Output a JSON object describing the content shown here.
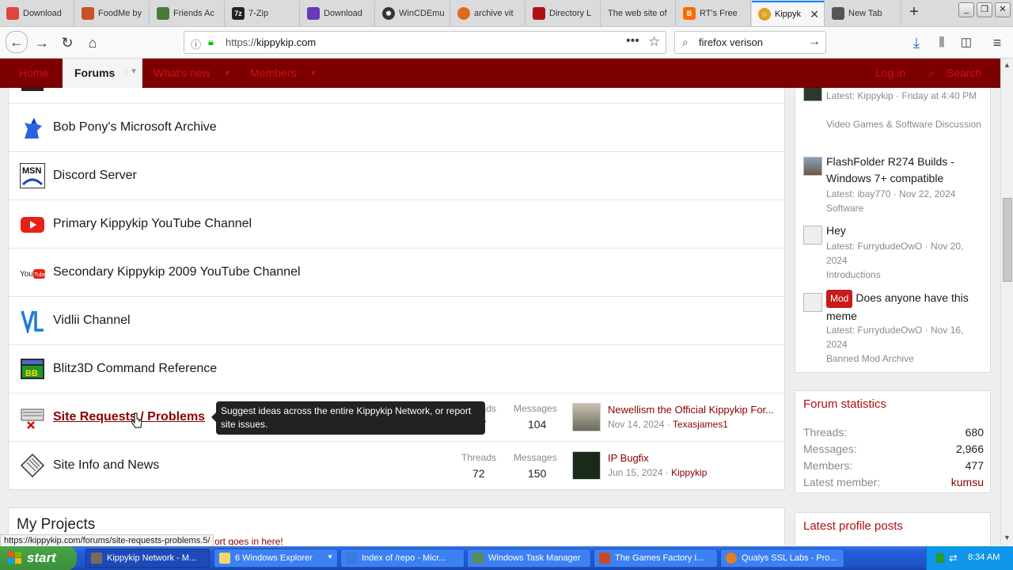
{
  "tabs": [
    {
      "label": "Download",
      "color": "#e0453a"
    },
    {
      "label": "FoodMe by",
      "color": "#c8512a"
    },
    {
      "label": "Friends Ac",
      "color": "#4a7a3a"
    },
    {
      "label": "7-Zip",
      "color": "#222222"
    },
    {
      "label": "Download",
      "color": "#6a3ab8"
    },
    {
      "label": "WinCDEmu",
      "color": "#333333"
    },
    {
      "label": "archive vit",
      "color": "#e06a1a"
    },
    {
      "label": "Directory L",
      "color": "#b01010"
    },
    {
      "label": "The web site of",
      "color": ""
    },
    {
      "label": "RT's Free",
      "color": "#ff6a00"
    },
    {
      "label": "Kippyk",
      "color": "#e0a020",
      "active": true
    },
    {
      "label": "New Tab",
      "color": "#555555"
    }
  ],
  "url": {
    "prefix": "https://",
    "host": "kippykip.com"
  },
  "search": {
    "value": "firefox verison"
  },
  "sitenav": {
    "home": "Home",
    "forums": "Forums",
    "whats_new": "What's new",
    "members": "Members",
    "login": "Log in",
    "search": "Search"
  },
  "nodes": [
    {
      "title": "Bob Pony's Microsoft Archive"
    },
    {
      "title": "Discord Server"
    },
    {
      "title": "Primary Kippykip YouTube Channel"
    },
    {
      "title": "Secondary Kippykip 2009 YouTube Channel"
    },
    {
      "title": "Vidlii Channel"
    },
    {
      "title": "Blitz3D Command Reference"
    },
    {
      "title": "Site Requests / Problems",
      "threads_label": "Threads",
      "threads": "27",
      "messages_label": "Messages",
      "messages": "104",
      "latest_title": "Newellism the Official Kippykip For...",
      "latest_date": "Nov 14, 2024",
      "latest_user": "Texasjames1"
    },
    {
      "title": "Site Info and News",
      "threads_label": "Threads",
      "threads": "72",
      "messages_label": "Messages",
      "messages": "150",
      "latest_title": "IP Bugfix",
      "latest_date": "Jun 15, 2024",
      "latest_user": "Kippykip"
    }
  ],
  "tooltip": "Suggest ideas across the entire Kippykip Network, or report site issues.",
  "myprojects": {
    "title": "My Projects",
    "sub": "ort goes in here!"
  },
  "sidebar_threads": [
    {
      "title": "",
      "meta1": "Latest: Kippykip · Friday at 4:40 PM",
      "meta2": "Video Games & Software Discussion"
    },
    {
      "title": "FlashFolder R274 Builds - Windows 7+ compatible",
      "meta1": "Latest: ibay770 · Nov 22, 2024",
      "meta2": "Software"
    },
    {
      "title": "Hey",
      "meta1": "Latest: FurrydudeOwO · Nov 20, 2024",
      "meta2": "Introductions"
    },
    {
      "badge": "Mod",
      "title": "Does anyone have this meme",
      "meta1": "Latest: FurrydudeOwO · Nov 16, 2024",
      "meta2": "Banned Mod Archive"
    }
  ],
  "forum_stats": {
    "title": "Forum statistics",
    "rows": [
      {
        "label": "Threads:",
        "value": "680"
      },
      {
        "label": "Messages:",
        "value": "2,966"
      },
      {
        "label": "Members:",
        "value": "477"
      },
      {
        "label": "Latest member:",
        "value": "kumsu"
      }
    ]
  },
  "profile_posts": {
    "title": "Latest profile posts"
  },
  "status_url": "https://kippykip.com/forums/site-requests-problems.5/",
  "taskbar": {
    "start": "start",
    "buttons": [
      {
        "label": "Kippykip Network - M...",
        "active": true
      },
      {
        "label": "6 Windows Explorer"
      },
      {
        "label": "Index of /repo - Micr..."
      },
      {
        "label": "Windows Task Manager"
      },
      {
        "label": "The Games Factory I..."
      },
      {
        "label": "Qualys SSL Labs - Pro..."
      }
    ],
    "clock": "8:34 AM"
  }
}
